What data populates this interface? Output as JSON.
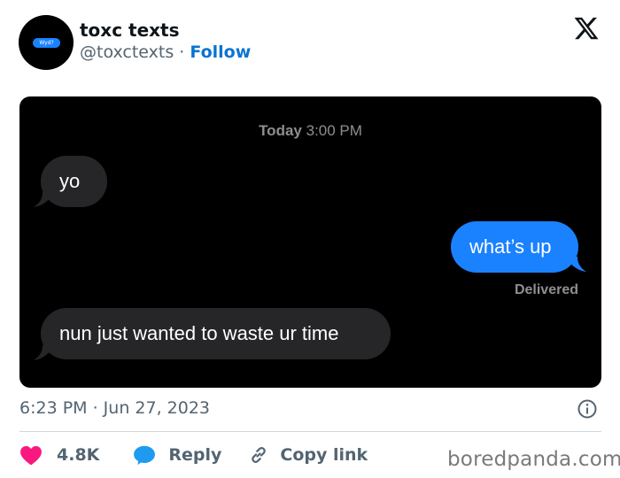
{
  "header": {
    "avatar_text": "Wyd?",
    "display_name": "toxc texts",
    "handle": "@toxctexts",
    "separator": "·",
    "follow_label": "Follow"
  },
  "chat": {
    "timestamp_day": "Today",
    "timestamp_time": "3:00 PM",
    "messages": [
      {
        "direction": "incoming",
        "text": "yo"
      },
      {
        "direction": "outgoing",
        "text": "what’s up"
      },
      {
        "direction": "incoming",
        "text": "nun just wanted to waste ur time"
      }
    ],
    "status": "Delivered"
  },
  "tweet": {
    "time": "6:23 PM · Jun 27, 2023",
    "likes": "4.8K",
    "reply_label": "Reply",
    "copy_link_label": "Copy link"
  },
  "watermark": "boredpanda.com",
  "colors": {
    "imessage_blue": "#1a82ff",
    "incoming_bubble": "#262628",
    "heart": "#f91880",
    "reply_blue": "#1d9bf0",
    "follow_blue": "#0a74d0"
  },
  "icons": [
    "x-logo-icon",
    "info-icon",
    "heart-icon",
    "reply-bubble-icon",
    "link-icon"
  ]
}
